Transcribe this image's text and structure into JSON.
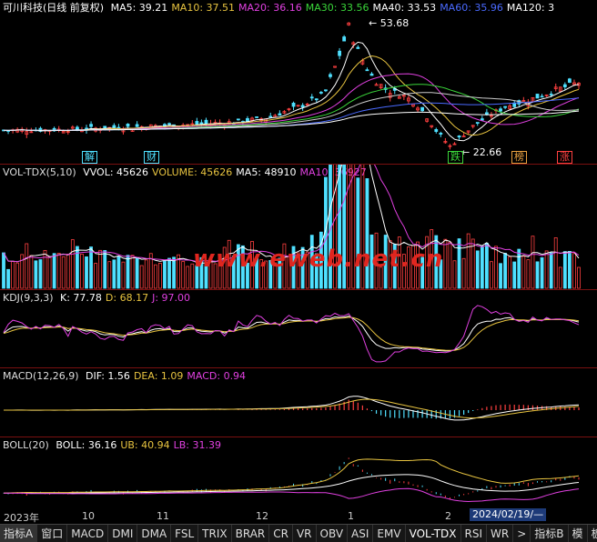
{
  "main": {
    "title": "可川科技(日线 前复权)",
    "ma": [
      {
        "label": "MA5: 39.21",
        "color": "#ffffff"
      },
      {
        "label": "MA10: 37.51",
        "color": "#e8c440"
      },
      {
        "label": "MA20: 36.16",
        "color": "#e040e0"
      },
      {
        "label": "MA30: 33.56",
        "color": "#3ad63a"
      },
      {
        "label": "MA40: 33.53",
        "color": "#ffffff"
      },
      {
        "label": "MA60: 35.96",
        "color": "#4a6aff"
      },
      {
        "label": "MA120: 3",
        "color": "#ffffff"
      }
    ],
    "high_label": "53.68",
    "low_label": "22.66",
    "events": [
      {
        "label": "解",
        "color": "#4fe0ff"
      },
      {
        "label": "财",
        "color": "#4fe0ff"
      },
      {
        "label": "跌",
        "color": "#3ad63a"
      },
      {
        "label": "榜",
        "color": "#e8a040"
      },
      {
        "label": "涨",
        "color": "#ff4040"
      }
    ]
  },
  "vol": {
    "name": "VOL-TDX(5,10)",
    "items": [
      {
        "label": "VVOL: 45626",
        "color": "#ffffff"
      },
      {
        "label": "VOLUME: 45626",
        "color": "#e8c440"
      },
      {
        "label": "MA5: 48910",
        "color": "#ffffff"
      },
      {
        "label": "MA10: 36927",
        "color": "#e040e0"
      }
    ]
  },
  "kdj": {
    "name": "KDJ(9,3,3)",
    "items": [
      {
        "label": "K: 77.78",
        "color": "#ffffff"
      },
      {
        "label": "D: 68.17",
        "color": "#e8c440"
      },
      {
        "label": "J: 97.00",
        "color": "#e040e0"
      }
    ]
  },
  "macd": {
    "name": "MACD(12,26,9)",
    "items": [
      {
        "label": "DIF: 1.56",
        "color": "#ffffff"
      },
      {
        "label": "DEA: 1.09",
        "color": "#e8c440"
      },
      {
        "label": "MACD: 0.94",
        "color": "#e040e0"
      }
    ]
  },
  "boll": {
    "name": "BOLL(20)",
    "items": [
      {
        "label": "BOLL: 36.16",
        "color": "#ffffff"
      },
      {
        "label": "UB: 40.94",
        "color": "#e8c440"
      },
      {
        "label": "LB: 31.39",
        "color": "#e040e0"
      }
    ]
  },
  "watermark": "www.eweb.net.cn",
  "axis": {
    "labels": [
      "2023年",
      "10",
      "11",
      "12",
      "1",
      "2"
    ],
    "date_tag": "2024/02/19/—"
  },
  "tabs": [
    "指标A",
    "窗口",
    "MACD",
    "DMI",
    "DMA",
    "FSL",
    "TRIX",
    "BRAR",
    "CR",
    "VR",
    "OBV",
    "ASI",
    "EMV",
    "VOL-TDX",
    "RSI",
    "WR",
    ">",
    "指标B",
    "模",
    "板"
  ],
  "colors": {
    "up": "#ff4040",
    "down": "#4fe0ff",
    "border": "#7a1010"
  }
}
